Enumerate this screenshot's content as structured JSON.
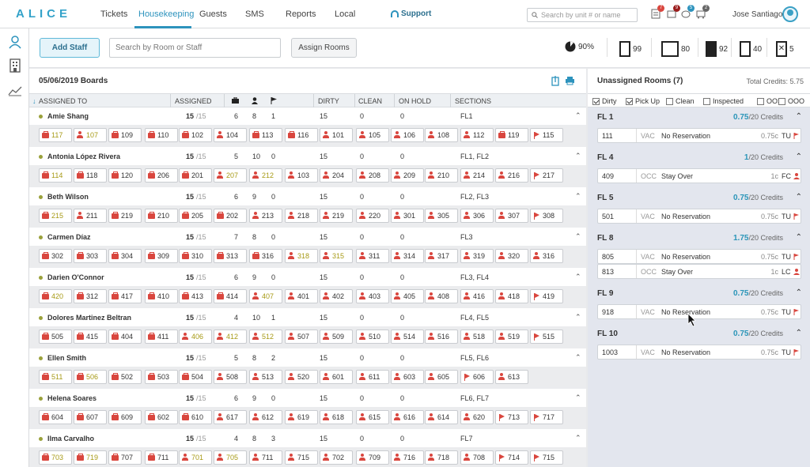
{
  "app": {
    "logo": "ALICE"
  },
  "nav": {
    "items": [
      "Tickets",
      "Housekeeping",
      "Guests",
      "SMS",
      "Reports",
      "Local"
    ],
    "support": "Support",
    "search_placeholder": "Search by unit # or name",
    "user": "Jose Santiago",
    "badges": [
      "7",
      "9",
      "5",
      "2"
    ]
  },
  "toolbar": {
    "add_staff": "Add Staff",
    "search_placeholder": "Search by Room or Staff",
    "assign_rooms": "Assign Rooms",
    "stats": [
      "90%",
      "99",
      "80",
      "92",
      "40",
      "5"
    ]
  },
  "board": {
    "title": "05/06/2019 Boards",
    "columns": [
      "ASSIGNED TO",
      "ASSIGNED",
      "DIRTY",
      "CLEAN",
      "ON HOLD",
      "SECTIONS"
    ],
    "staff": [
      {
        "name": "Amie Shang",
        "assigned": "15",
        "of": "/15",
        "c1": "6",
        "c2": "8",
        "c3": "1",
        "dirty": "15",
        "clean": "0",
        "hold": "0",
        "sections": "FL1",
        "rooms": [
          [
            "117",
            "bag",
            "y"
          ],
          [
            "107",
            "person",
            "y"
          ],
          [
            "109",
            "bag",
            ""
          ],
          [
            "110",
            "bag",
            ""
          ],
          [
            "102",
            "bag",
            ""
          ],
          [
            "104",
            "person",
            ""
          ],
          [
            "113",
            "bag",
            ""
          ],
          [
            "116",
            "bag",
            ""
          ],
          [
            "101",
            "person",
            ""
          ],
          [
            "105",
            "person",
            ""
          ],
          [
            "106",
            "person",
            ""
          ],
          [
            "108",
            "person",
            ""
          ],
          [
            "112",
            "person",
            ""
          ],
          [
            "119",
            "bag",
            ""
          ],
          [
            "115",
            "flag",
            ""
          ]
        ]
      },
      {
        "name": "Antonia López Rivera",
        "assigned": "15",
        "of": "/15",
        "c1": "5",
        "c2": "10",
        "c3": "0",
        "dirty": "15",
        "clean": "0",
        "hold": "0",
        "sections": "FL1, FL2",
        "rooms": [
          [
            "114",
            "bag",
            "y"
          ],
          [
            "118",
            "bag",
            ""
          ],
          [
            "120",
            "bag",
            ""
          ],
          [
            "206",
            "bag",
            ""
          ],
          [
            "201",
            "bag",
            ""
          ],
          [
            "207",
            "person",
            "y"
          ],
          [
            "212",
            "person",
            "y"
          ],
          [
            "103",
            "person",
            ""
          ],
          [
            "204",
            "person",
            ""
          ],
          [
            "208",
            "person",
            ""
          ],
          [
            "209",
            "person",
            ""
          ],
          [
            "210",
            "person",
            ""
          ],
          [
            "214",
            "person",
            ""
          ],
          [
            "216",
            "person",
            ""
          ],
          [
            "217",
            "flag",
            ""
          ]
        ]
      },
      {
        "name": "Beth Wilson",
        "assigned": "15",
        "of": "/15",
        "c1": "6",
        "c2": "9",
        "c3": "0",
        "dirty": "15",
        "clean": "0",
        "hold": "0",
        "sections": "FL2, FL3",
        "rooms": [
          [
            "215",
            "bag",
            "y"
          ],
          [
            "211",
            "person",
            ""
          ],
          [
            "219",
            "bag",
            ""
          ],
          [
            "210",
            "bag",
            ""
          ],
          [
            "205",
            "bag",
            ""
          ],
          [
            "202",
            "bag",
            ""
          ],
          [
            "213",
            "person",
            ""
          ],
          [
            "218",
            "person",
            ""
          ],
          [
            "219",
            "person",
            ""
          ],
          [
            "220",
            "person",
            ""
          ],
          [
            "301",
            "person",
            ""
          ],
          [
            "305",
            "person",
            ""
          ],
          [
            "306",
            "person",
            ""
          ],
          [
            "307",
            "person",
            ""
          ],
          [
            "308",
            "flag",
            ""
          ]
        ]
      },
      {
        "name": "Carmen Díaz",
        "assigned": "15",
        "of": "/15",
        "c1": "7",
        "c2": "8",
        "c3": "0",
        "dirty": "15",
        "clean": "0",
        "hold": "0",
        "sections": "FL3",
        "rooms": [
          [
            "302",
            "bag",
            ""
          ],
          [
            "303",
            "bag",
            ""
          ],
          [
            "304",
            "bag",
            ""
          ],
          [
            "309",
            "bag",
            ""
          ],
          [
            "310",
            "bag",
            ""
          ],
          [
            "313",
            "bag",
            ""
          ],
          [
            "316",
            "bag",
            ""
          ],
          [
            "318",
            "person",
            "y"
          ],
          [
            "315",
            "person",
            "y"
          ],
          [
            "311",
            "person",
            ""
          ],
          [
            "314",
            "person",
            ""
          ],
          [
            "317",
            "person",
            ""
          ],
          [
            "319",
            "person",
            ""
          ],
          [
            "320",
            "person",
            ""
          ],
          [
            "316",
            "person",
            ""
          ]
        ]
      },
      {
        "name": "Darien O'Connor",
        "assigned": "15",
        "of": "/15",
        "c1": "6",
        "c2": "9",
        "c3": "0",
        "dirty": "15",
        "clean": "0",
        "hold": "0",
        "sections": "FL3, FL4",
        "rooms": [
          [
            "420",
            "bag",
            "y"
          ],
          [
            "312",
            "bag",
            ""
          ],
          [
            "417",
            "bag",
            ""
          ],
          [
            "410",
            "bag",
            ""
          ],
          [
            "413",
            "bag",
            ""
          ],
          [
            "414",
            "bag",
            ""
          ],
          [
            "407",
            "person",
            "y"
          ],
          [
            "401",
            "person",
            ""
          ],
          [
            "402",
            "person",
            ""
          ],
          [
            "403",
            "person",
            ""
          ],
          [
            "405",
            "person",
            ""
          ],
          [
            "408",
            "person",
            ""
          ],
          [
            "416",
            "person",
            ""
          ],
          [
            "418",
            "person",
            ""
          ],
          [
            "419",
            "flag",
            ""
          ]
        ]
      },
      {
        "name": "Dolores Martinez Beltran",
        "assigned": "15",
        "of": "/15",
        "c1": "4",
        "c2": "10",
        "c3": "1",
        "dirty": "15",
        "clean": "0",
        "hold": "0",
        "sections": "FL4, FL5",
        "rooms": [
          [
            "505",
            "bag",
            ""
          ],
          [
            "415",
            "bag",
            ""
          ],
          [
            "404",
            "bag",
            ""
          ],
          [
            "411",
            "bag",
            ""
          ],
          [
            "406",
            "person",
            "y"
          ],
          [
            "412",
            "person",
            "y"
          ],
          [
            "512",
            "person",
            "y"
          ],
          [
            "507",
            "person",
            ""
          ],
          [
            "509",
            "person",
            ""
          ],
          [
            "510",
            "person",
            ""
          ],
          [
            "514",
            "person",
            ""
          ],
          [
            "516",
            "person",
            ""
          ],
          [
            "518",
            "person",
            ""
          ],
          [
            "519",
            "person",
            ""
          ],
          [
            "515",
            "flag",
            ""
          ]
        ]
      },
      {
        "name": "Ellen Smith",
        "assigned": "15",
        "of": "/15",
        "c1": "5",
        "c2": "8",
        "c3": "2",
        "dirty": "15",
        "clean": "0",
        "hold": "0",
        "sections": "FL5, FL6",
        "rooms": [
          [
            "511",
            "bag",
            "y"
          ],
          [
            "506",
            "bag",
            "y"
          ],
          [
            "502",
            "bag",
            ""
          ],
          [
            "503",
            "bag",
            ""
          ],
          [
            "504",
            "bag",
            ""
          ],
          [
            "508",
            "person",
            ""
          ],
          [
            "513",
            "person",
            ""
          ],
          [
            "520",
            "person",
            ""
          ],
          [
            "601",
            "person",
            ""
          ],
          [
            "611",
            "person",
            ""
          ],
          [
            "603",
            "person",
            ""
          ],
          [
            "605",
            "person",
            ""
          ],
          [
            "606",
            "flag",
            ""
          ],
          [
            "613",
            "person",
            ""
          ]
        ]
      },
      {
        "name": "Helena Soares",
        "assigned": "15",
        "of": "/15",
        "c1": "6",
        "c2": "9",
        "c3": "0",
        "dirty": "15",
        "clean": "0",
        "hold": "0",
        "sections": "FL6, FL7",
        "rooms": [
          [
            "604",
            "bag",
            ""
          ],
          [
            "607",
            "bag",
            ""
          ],
          [
            "609",
            "bag",
            ""
          ],
          [
            "602",
            "bag",
            ""
          ],
          [
            "610",
            "bag",
            ""
          ],
          [
            "617",
            "person",
            ""
          ],
          [
            "612",
            "person",
            ""
          ],
          [
            "619",
            "person",
            ""
          ],
          [
            "618",
            "person",
            ""
          ],
          [
            "615",
            "person",
            ""
          ],
          [
            "616",
            "person",
            ""
          ],
          [
            "614",
            "person",
            ""
          ],
          [
            "620",
            "person",
            ""
          ],
          [
            "713",
            "flag",
            ""
          ],
          [
            "717",
            "flag",
            ""
          ]
        ]
      },
      {
        "name": "Ilma Carvalho",
        "assigned": "15",
        "of": "/15",
        "c1": "4",
        "c2": "8",
        "c3": "3",
        "dirty": "15",
        "clean": "0",
        "hold": "0",
        "sections": "FL7",
        "rooms": [
          [
            "703",
            "bag",
            "y"
          ],
          [
            "719",
            "bag",
            "y"
          ],
          [
            "707",
            "bag",
            ""
          ],
          [
            "711",
            "bag",
            ""
          ],
          [
            "701",
            "person",
            "y"
          ],
          [
            "705",
            "person",
            "y"
          ],
          [
            "711",
            "person",
            ""
          ],
          [
            "715",
            "person",
            ""
          ],
          [
            "702",
            "person",
            ""
          ],
          [
            "709",
            "person",
            ""
          ],
          [
            "716",
            "person",
            ""
          ],
          [
            "718",
            "person",
            ""
          ],
          [
            "708",
            "person",
            ""
          ],
          [
            "714",
            "flag",
            ""
          ],
          [
            "715",
            "flag",
            ""
          ]
        ]
      }
    ]
  },
  "unassigned": {
    "title": "Unassigned Rooms (7)",
    "total_credits": "Total Credits: 5.75",
    "filters": [
      {
        "label": "Dirty",
        "on": true
      },
      {
        "label": "Pick Up",
        "on": true
      },
      {
        "label": "Clean",
        "on": false
      },
      {
        "label": "Inspected",
        "on": false
      },
      {
        "label": "OOS",
        "on": false
      },
      {
        "label": "OOO",
        "on": false
      }
    ],
    "floors": [
      {
        "name": "FL 1",
        "credit": "0.75",
        "of": "/20 Credits",
        "rooms": [
          {
            "num": "111",
            "st": "VAC",
            "res": "No Reservation",
            "cr": "0.75c",
            "tag": "TU",
            "flag": true
          }
        ]
      },
      {
        "name": "FL 4",
        "credit": "1",
        "of": "/20 Credits",
        "rooms": [
          {
            "num": "409",
            "st": "OCC",
            "res": "Stay Over",
            "cr": "1c",
            "tag": "FC",
            "flag": false
          }
        ]
      },
      {
        "name": "FL 5",
        "credit": "0.75",
        "of": "/20 Credits",
        "rooms": [
          {
            "num": "501",
            "st": "VAC",
            "res": "No Reservation",
            "cr": "0.75c",
            "tag": "TU",
            "flag": true
          }
        ]
      },
      {
        "name": "FL 8",
        "credit": "1.75",
        "of": "/20 Credits",
        "rooms": [
          {
            "num": "805",
            "st": "VAC",
            "res": "No Reservation",
            "cr": "0.75c",
            "tag": "TU",
            "flag": true
          },
          {
            "num": "813",
            "st": "OCC",
            "res": "Stay Over",
            "cr": "1c",
            "tag": "LC",
            "flag": false
          }
        ]
      },
      {
        "name": "FL 9",
        "credit": "0.75",
        "of": "/20 Credits",
        "rooms": [
          {
            "num": "918",
            "st": "VAC",
            "res": "No Reservation",
            "cr": "0.75c",
            "tag": "TU",
            "flag": true
          }
        ]
      },
      {
        "name": "FL 10",
        "credit": "0.75",
        "of": "/20 Credits",
        "rooms": [
          {
            "num": "1003",
            "st": "VAC",
            "res": "No Reservation",
            "cr": "0.75c",
            "tag": "TU",
            "flag": true
          }
        ]
      }
    ]
  },
  "colors": {
    "accent": "#2d93bd",
    "red": "#d9463e",
    "yellow_text": "#a79a16"
  }
}
